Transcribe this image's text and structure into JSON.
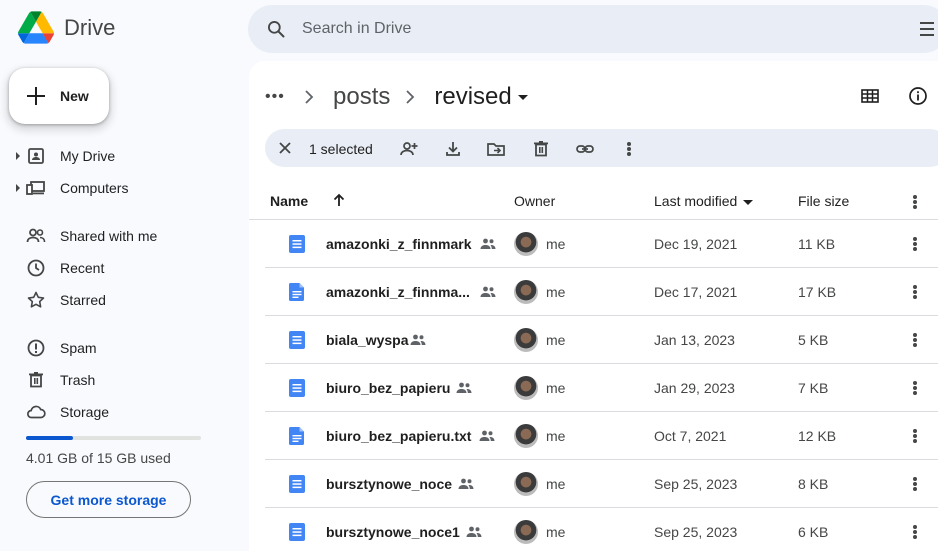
{
  "app": {
    "name": "Drive"
  },
  "search": {
    "placeholder": "Search in Drive"
  },
  "new_button": {
    "label": "New"
  },
  "sidebar": {
    "items": [
      {
        "label": "My Drive",
        "icon": "my-drive-icon",
        "expandable": true
      },
      {
        "label": "Computers",
        "icon": "computers-icon",
        "expandable": true
      },
      {
        "label": "Shared with me",
        "icon": "shared-with-me-icon",
        "expandable": false
      },
      {
        "label": "Recent",
        "icon": "clock-icon",
        "expandable": false
      },
      {
        "label": "Starred",
        "icon": "star-icon",
        "expandable": false
      },
      {
        "label": "Spam",
        "icon": "spam-icon",
        "expandable": false
      },
      {
        "label": "Trash",
        "icon": "trash-icon",
        "expandable": false
      },
      {
        "label": "Storage",
        "icon": "cloud-icon",
        "expandable": false
      }
    ],
    "storage": {
      "used_fraction": 0.267,
      "text": "4.01 GB of 15 GB used",
      "button": "Get more storage"
    }
  },
  "breadcrumb": {
    "items": [
      "posts",
      "revised"
    ]
  },
  "selection": {
    "count_label": "1 selected"
  },
  "table": {
    "headers": {
      "name": "Name",
      "owner": "Owner",
      "modified": "Last modified",
      "size": "File size"
    },
    "rows": [
      {
        "name": "amazonki_z_finnmark",
        "type": "doc",
        "owner": "me",
        "modified": "Dec 19, 2021",
        "size": "11 KB"
      },
      {
        "name": "amazonki_z_finnma...",
        "type": "txt",
        "owner": "me",
        "modified": "Dec 17, 2021",
        "size": "17 KB"
      },
      {
        "name": "biala_wyspa",
        "type": "doc",
        "owner": "me",
        "modified": "Jan 13, 2023",
        "size": "5 KB"
      },
      {
        "name": "biuro_bez_papieru",
        "type": "doc",
        "owner": "me",
        "modified": "Jan 29, 2023",
        "size": "7 KB"
      },
      {
        "name": "biuro_bez_papieru.txt",
        "type": "txt",
        "owner": "me",
        "modified": "Oct 7, 2021",
        "size": "12 KB"
      },
      {
        "name": "bursztynowe_noce",
        "type": "doc",
        "owner": "me",
        "modified": "Sep 25, 2023",
        "size": "8 KB"
      },
      {
        "name": "bursztynowe_noce1",
        "type": "doc",
        "owner": "me",
        "modified": "Sep 25, 2023",
        "size": "6 KB"
      }
    ]
  },
  "colors": {
    "accent": "#0b57d0",
    "doc_blue": "#4285f4",
    "bg": "#f8fafd",
    "search_bg": "#e9eef6"
  }
}
